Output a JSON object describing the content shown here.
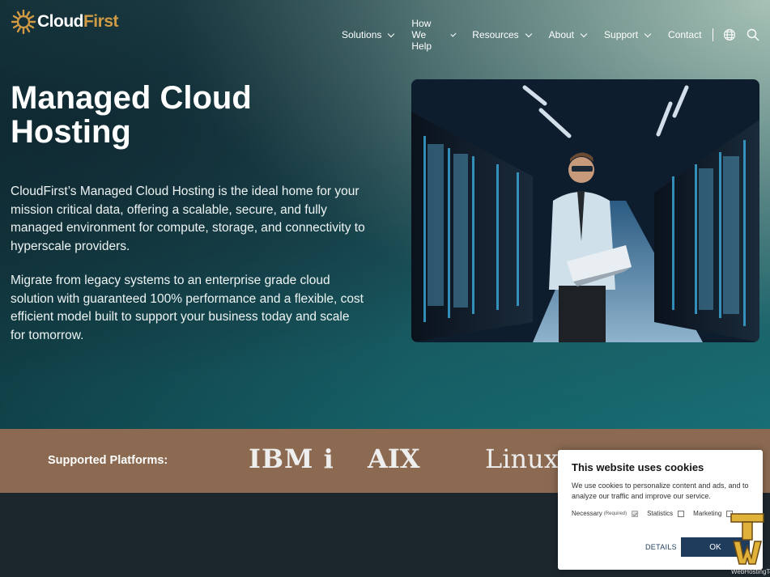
{
  "header": {
    "logo": {
      "part1": "Cloud",
      "part2": "First",
      "icon": "sunburst-logo-icon"
    },
    "nav": [
      {
        "label": "Solutions",
        "has_dropdown": true
      },
      {
        "label": "How We Help",
        "has_dropdown": true
      },
      {
        "label": "Resources",
        "has_dropdown": true
      },
      {
        "label": "About",
        "has_dropdown": true
      },
      {
        "label": "Support",
        "has_dropdown": true
      },
      {
        "label": "Contact",
        "has_dropdown": false
      }
    ],
    "icons": [
      "globe-icon",
      "search-icon"
    ]
  },
  "hero": {
    "title": "Managed Cloud Hosting",
    "paragraph1": "CloudFirst’s Managed Cloud Hosting is the ideal home for your mission critical data, offering a scalable, secure, and fully managed environment for compute, storage, and connectivity to hyperscale providers.",
    "paragraph2": "Migrate from legacy systems to an enterprise grade cloud solution with guaranteed 100% performance and a flexible, cost efficient model built to support your business today and scale for tomorrow."
  },
  "platforms": {
    "label": "Supported Platforms:",
    "items": [
      "IBM i",
      "AIX",
      "Linux"
    ]
  },
  "cookie": {
    "title": "This website uses cookies",
    "text": "We use cookies to personalize content and ads, and to analyze our traffic and improve our service.",
    "options": [
      {
        "label": "Necessary",
        "note": "(Required)",
        "checked": true
      },
      {
        "label": "Statistics",
        "checked": false
      },
      {
        "label": "Marketing",
        "checked": false
      }
    ],
    "details_label": "DETAILS",
    "ok_label": "OK"
  },
  "watermark": {
    "text": "WebHostingTop.com"
  },
  "colors": {
    "accent_gold": "#d19a45",
    "band_brown": "#8b6a51",
    "button_navy": "#1f3c5c",
    "footer_dark": "#1c272d"
  }
}
